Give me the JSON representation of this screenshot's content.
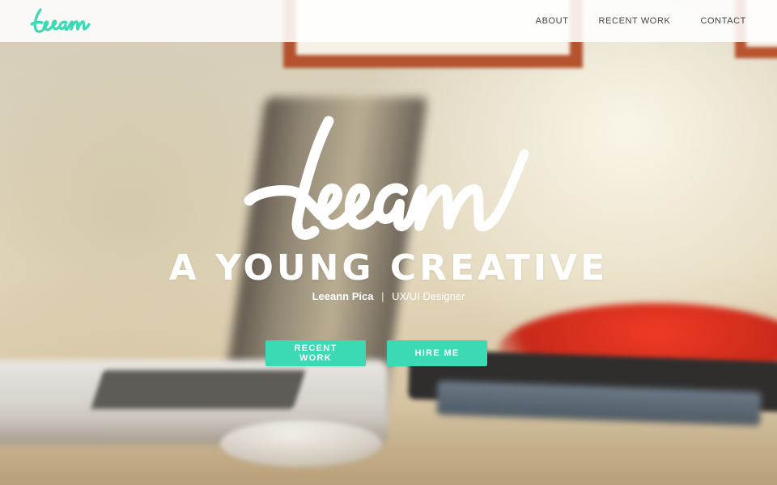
{
  "brand": {
    "logo_text": "Leeann",
    "accent_color": "#3bd9b4"
  },
  "nav": {
    "items": [
      {
        "label": "ABOUT"
      },
      {
        "label": "RECENT WORK"
      },
      {
        "label": "CONTACT"
      }
    ]
  },
  "hero": {
    "script_title": "Leeann",
    "tagline": "A YOUNG CREATIVE",
    "name": "Leeann Pica",
    "separator": "|",
    "role": "UX/UI Designer",
    "buttons": {
      "recent_work": "RECENT WORK",
      "hire_me": "HIRE ME"
    }
  }
}
